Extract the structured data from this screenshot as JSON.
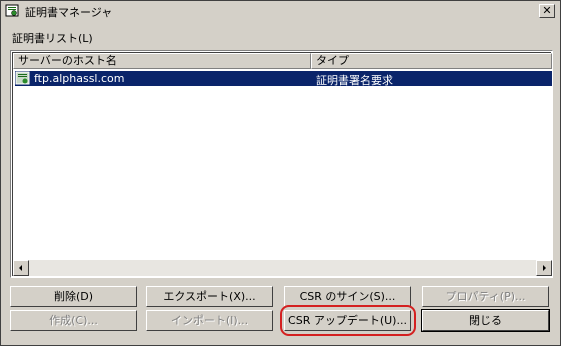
{
  "window": {
    "title": "証明書マネージャ",
    "close_label": "✕"
  },
  "list": {
    "label": "証明書リスト(L)",
    "columns": [
      "サーバーのホスト名",
      "タイプ"
    ],
    "rows": [
      {
        "host": "ftp.alphassl.com",
        "type": "証明書署名要求",
        "selected": true
      }
    ]
  },
  "buttons": {
    "delete": "削除(D)",
    "export": "エクスポート(X)...",
    "csr_sign": "CSR のサイン(S)...",
    "properties": "プロパティ(P)...",
    "create": "作成(C)...",
    "import": "インポート(I)...",
    "csr_update": "CSR アップデート(U)...",
    "close": "閉じる"
  },
  "colors": {
    "selection": "#0a246a",
    "highlight_ring": "#d42020",
    "face": "#d4d0c8"
  }
}
